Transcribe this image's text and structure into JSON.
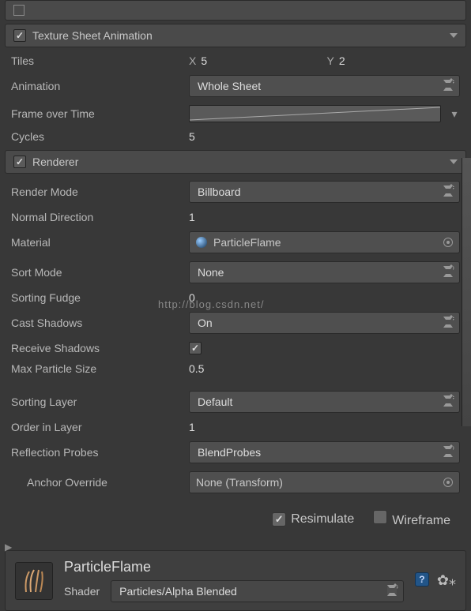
{
  "modules": {
    "texSheet": {
      "title": "Texture Sheet Animation",
      "enabled": true
    },
    "renderer": {
      "title": "Renderer",
      "enabled": true
    }
  },
  "texSheet": {
    "tilesLabel": "Tiles",
    "tilesXLabel": "X",
    "tilesX": "5",
    "tilesYLabel": "Y",
    "tilesY": "2",
    "animationLabel": "Animation",
    "animation": "Whole Sheet",
    "frameOverTimeLabel": "Frame over Time",
    "cyclesLabel": "Cycles",
    "cycles": "5"
  },
  "renderer": {
    "renderModeLabel": "Render Mode",
    "renderMode": "Billboard",
    "normalDirLabel": "Normal Direction",
    "normalDir": "1",
    "materialLabel": "Material",
    "material": "ParticleFlame",
    "sortModeLabel": "Sort Mode",
    "sortMode": "None",
    "sortingFudgeLabel": "Sorting Fudge",
    "sortingFudge": "0",
    "castShadowsLabel": "Cast Shadows",
    "castShadows": "On",
    "receiveShadowsLabel": "Receive Shadows",
    "receiveShadows": true,
    "maxParticleSizeLabel": "Max Particle Size",
    "maxParticleSize": "0.5",
    "sortingLayerLabel": "Sorting Layer",
    "sortingLayer": "Default",
    "orderInLayerLabel": "Order in Layer",
    "orderInLayer": "1",
    "reflectionProbesLabel": "Reflection Probes",
    "reflectionProbes": "BlendProbes",
    "anchorOverrideLabel": "Anchor Override",
    "anchorOverride": "None (Transform)"
  },
  "footer": {
    "resimulateLabel": "Resimulate",
    "resimulate": true,
    "wireframeLabel": "Wireframe",
    "wireframe": false
  },
  "materialHeader": {
    "name": "ParticleFlame",
    "shaderLabel": "Shader",
    "shader": "Particles/Alpha Blended"
  },
  "watermark": "http://blog.csdn.net/"
}
